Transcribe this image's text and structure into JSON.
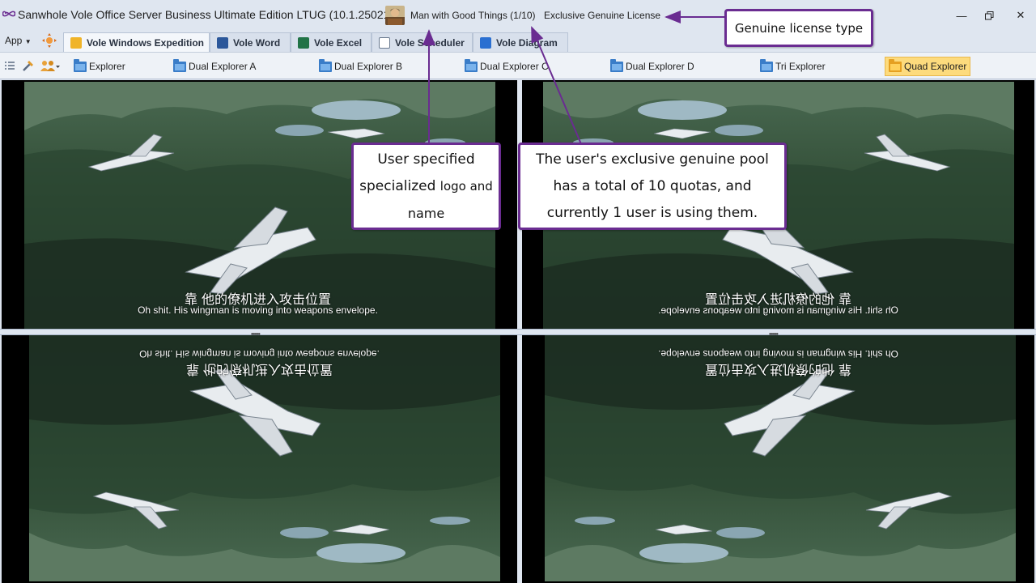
{
  "window": {
    "title": "Sanwhole Vole Office Server Business Ultimate Edition LTUG (10.1.25021)",
    "user_name": "Man with Good Things (1/10)",
    "license_type": "Exclusive Genuine License",
    "controls": {
      "minimize": "minimize-icon",
      "maximize": "restore-icon",
      "close": "close-icon"
    }
  },
  "menu": {
    "app_label": "App"
  },
  "tabs": [
    {
      "label": "Vole Windows Expedition",
      "icon": "expedition-icon",
      "color": "#f0b429",
      "active": true
    },
    {
      "label": "Vole Word",
      "icon": "word-icon",
      "color": "#2b579a"
    },
    {
      "label": "Vole Excel",
      "icon": "excel-icon",
      "color": "#217346"
    },
    {
      "label": "Vole Scheduler",
      "icon": "scheduler-icon",
      "color": "#6a7a90"
    },
    {
      "label": "Vole Diagram",
      "icon": "diagram-icon",
      "color": "#2a6fd1"
    }
  ],
  "toolbar": {
    "explorers": [
      {
        "label": "Explorer"
      },
      {
        "label": "Dual Explorer A"
      },
      {
        "label": "Dual Explorer B"
      },
      {
        "label": "Dual Explorer C"
      },
      {
        "label": "Dual Explorer D"
      },
      {
        "label": "Tri Explorer"
      },
      {
        "label": "Quad Explorer",
        "active": true
      }
    ]
  },
  "video": {
    "subtitle_cn": "靠 他的僚机进入攻击位置",
    "subtitle_en": "Oh shit. His wingman is moving into weapons envelope."
  },
  "callouts": {
    "license": "Genuine license type",
    "logo_line1": "User specified",
    "logo_line2a": "specialized",
    "logo_line2b": "logo and",
    "logo_line3": "name",
    "quota_line1": "The user's exclusive genuine pool",
    "quota_line2": "has a total of 10 quotas, and",
    "quota_line3": "currently 1 user is using them."
  },
  "colors": {
    "accent": "#6a2c91",
    "active_tool": "#fddb7d"
  }
}
